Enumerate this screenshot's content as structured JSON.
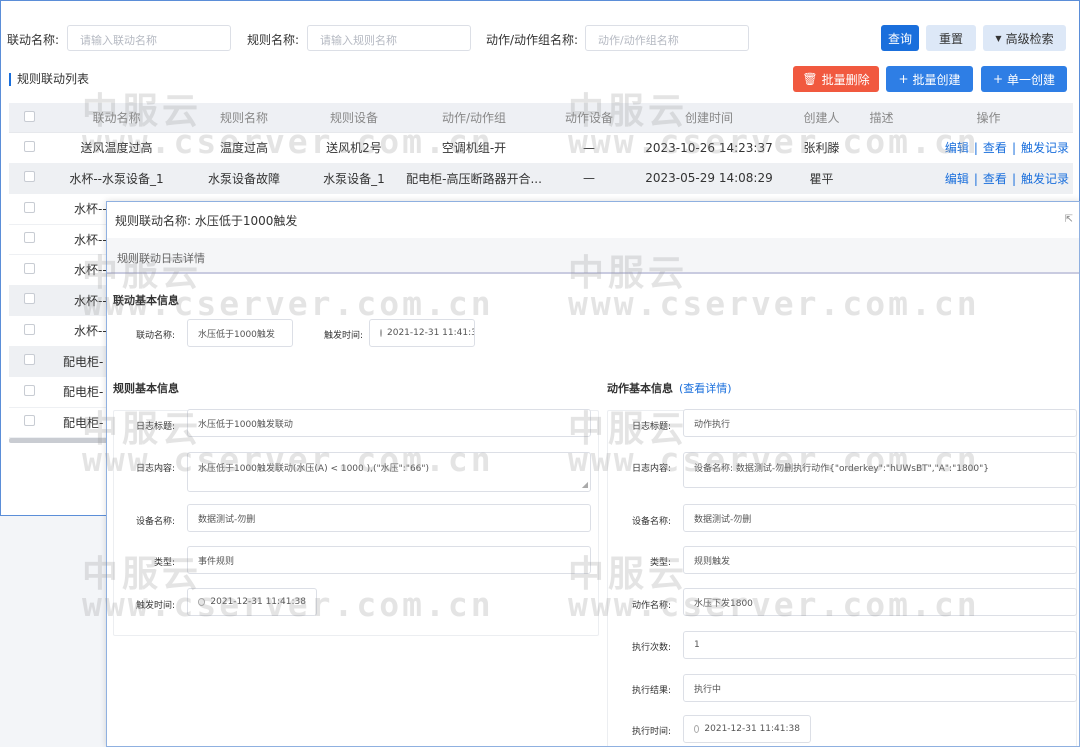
{
  "filters": {
    "linkage_name_label": "联动名称:",
    "linkage_name_placeholder": "请输入联动名称",
    "rule_name_label": "规则名称:",
    "rule_name_placeholder": "请输入规则名称",
    "action_label": "动作/动作组名称:",
    "action_placeholder": "动作/动作组名称",
    "query": "查询",
    "reset": "重置",
    "advanced": "高级检索"
  },
  "list": {
    "title": "规则联动列表",
    "batch_delete": "批量删除",
    "batch_create": "批量创建",
    "single_create": "单一创建",
    "columns": [
      "联动名称",
      "规则名称",
      "规则设备",
      "动作/动作组",
      "动作设备",
      "创建时间",
      "创建人",
      "描述",
      "操作"
    ],
    "rows": [
      {
        "name": "送风温度过高",
        "rule": "温度过高",
        "device": "送风机2号",
        "action": "空调机组-开",
        "action_device": "—",
        "time": "2023-10-26 14:23:37",
        "creator": "张利滕"
      },
      {
        "name": "水杯--水泵设备_1",
        "rule": "水泵设备故障",
        "device": "水泵设备_1",
        "action": "配电柜-高压断路器开合...",
        "action_device": "—",
        "time": "2023-05-29 14:08:29",
        "creator": "瞿平"
      },
      {
        "name": "水杯--"
      },
      {
        "name": "水杯--"
      },
      {
        "name": "水杯--"
      },
      {
        "name": "水杯--"
      },
      {
        "name": "水杯--"
      },
      {
        "name": "配电柜-"
      },
      {
        "name": "配电柜-"
      },
      {
        "name": "配电柜-"
      }
    ],
    "ops": {
      "edit": "编辑",
      "view": "查看",
      "trigger": "触发记录"
    }
  },
  "modal": {
    "title": "规则联动名称: 水压低于1000触发",
    "tab": "规则联动日志详情",
    "linkage_section": "联动基本信息",
    "linkage_name_label": "联动名称:",
    "linkage_name": "水压低于1000触发",
    "trigger_time_label": "触发时间:",
    "trigger_time": "2021-12-31 11:41:3",
    "rule_section": "规则基本信息",
    "rule": {
      "log_title_label": "日志标题:",
      "log_title": "水压低于1000触发联动",
      "log_content_label": "日志内容:",
      "log_content": "水压低于1000触发联动(水压(A) < 1000 ),(\"水压\":\"66\")",
      "device_label": "设备名称:",
      "device": "数据测试-勿删",
      "type_label": "类型:",
      "type": "事件规则",
      "trigger_label": "触发时间:",
      "trigger_time": "2021-12-31 11:41:38"
    },
    "action_section": "动作基本信息",
    "action_detail_link": "(查看详情)",
    "action": {
      "log_title_label": "日志标题:",
      "log_title": "动作执行",
      "log_content_label": "日志内容:",
      "log_content": "设备名称: 数据测试-勿删执行动作{\"orderkey\":\"hUWsBT\",\"A\":\"1800\"}",
      "device_label": "设备名称:",
      "device": "数据测试-勿删",
      "type_label": "类型:",
      "type": "规则触发",
      "action_name_label": "动作名称:",
      "action_name": "水压下发1800",
      "exec_count_label": "执行次数:",
      "exec_count": "1",
      "exec_result_label": "执行结果:",
      "exec_result": "执行中",
      "exec_time_label": "执行时间:",
      "exec_time": "2021-12-31 11:41:38"
    }
  },
  "watermark": {
    "cn": "中服云",
    "en": "www.cserver.com.cn"
  }
}
